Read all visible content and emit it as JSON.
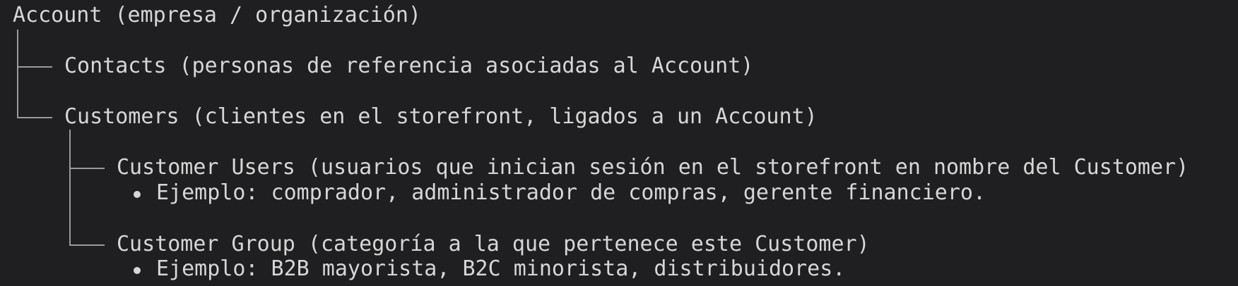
{
  "tree": {
    "root": "Account (empresa / organización)",
    "contacts": "Contacts (personas de referencia asociadas al Account)",
    "customers": "Customers (clientes en el storefront, ligados a un Account)",
    "customer_users": {
      "label": "Customer Users (usuarios que inician sesión en el storefront en nombre del Customer)",
      "example": "Ejemplo: comprador, administrador de compras, gerente financiero."
    },
    "customer_group": {
      "label": "Customer Group (categoría a la que pertenece este Customer)",
      "example": "Ejemplo: B2B mayorista, B2C minorista, distribuidores."
    }
  },
  "colors": {
    "background": "#1f1f21",
    "text": "#d6d6d6",
    "connector": "#9a9a9a"
  }
}
